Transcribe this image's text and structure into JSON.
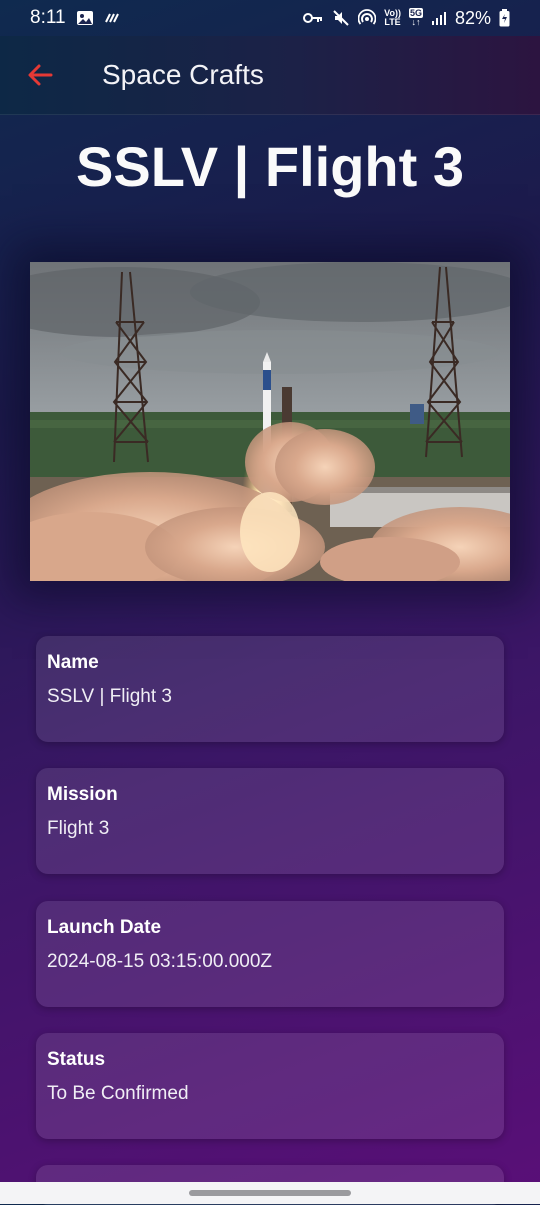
{
  "status_bar": {
    "time": "8:11",
    "battery_percent": "82%",
    "network": "5G",
    "volte_top": "Vo))",
    "volte_bottom": "LTE"
  },
  "app_bar": {
    "title": "Space Crafts",
    "back_icon": "arrow-left-icon",
    "accent_color": "#e53935"
  },
  "page": {
    "title": "SSLV | Flight 3"
  },
  "hero_image": {
    "icon": "rocket-launch-photo"
  },
  "details": [
    {
      "label": "Name",
      "value": "SSLV | Flight 3"
    },
    {
      "label": "Mission",
      "value": "Flight 3"
    },
    {
      "label": "Launch Date",
      "value": "2024-08-15 03:15:00.000Z"
    },
    {
      "label": "Status",
      "value": "To Be Confirmed"
    }
  ]
}
